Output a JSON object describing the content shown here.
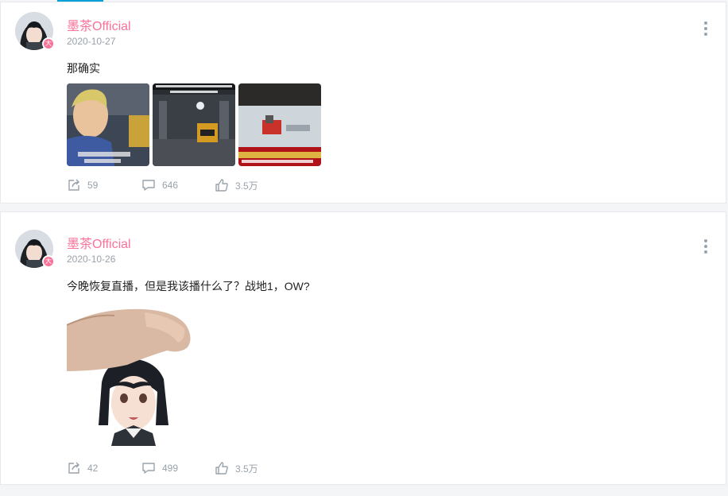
{
  "posts": [
    {
      "username": "墨茶Official",
      "date": "2020-10-27",
      "text": "那确实",
      "images": [
        {
          "alt": "video-still-person",
          "caption": "......"
        },
        {
          "alt": "video-still-forklift-warehouse",
          "caption": "中国工人拥有精湛的技术更好的操作"
        },
        {
          "alt": "video-still-news-forklift",
          "caption": "叉车司机 违章被"
        }
      ],
      "actions": {
        "share": "59",
        "comment": "646",
        "like": "3.5万"
      }
    },
    {
      "username": "墨茶Official",
      "date": "2020-10-26",
      "text": "今晚恢复直播，但是我该播什么了？战地1，OW?",
      "actions": {
        "share": "42",
        "comment": "499",
        "like": "3.5万"
      }
    }
  ],
  "colors": {
    "accent": "#00a1d6",
    "username": "#fb7299",
    "muted": "#99a2aa"
  },
  "icons": [
    "share-icon",
    "comment-icon",
    "like-icon",
    "more-icon"
  ]
}
